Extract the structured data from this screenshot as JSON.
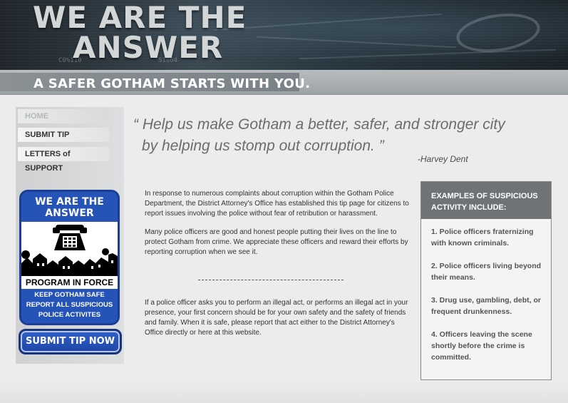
{
  "banner": {
    "title_line1": "WE ARE THE",
    "title_line2": "ANSWER",
    "tagline": "A SAFER GOTHAM STARTS WITH YOU."
  },
  "nav": {
    "items": [
      {
        "label": "HOME",
        "active": true
      },
      {
        "label": "SUBMIT TIP",
        "active": false
      },
      {
        "label": "LETTERS of SUPPORT",
        "active": false
      }
    ]
  },
  "promo": {
    "title_line1": "WE ARE THE",
    "title_line2": "ANSWER",
    "icon": "telephone-icon",
    "banner": "PROGRAM IN FORCE",
    "sub_line1": "KEEP GOTHAM SAFE",
    "sub_line2": "REPORT ALL SUSPICIOUS",
    "sub_line3": "POLICE ACTIVITES"
  },
  "submit_button": "SUBMIT TIP NOW",
  "quote": {
    "line1": "“ Help us make Gotham a better, safer, and stronger city",
    "line2": "by helping us stomp out corruption. ”",
    "author": "-Harvey Dent"
  },
  "body": {
    "para1": "In response to numerous complaints about corruption within the Gotham Police Department, the District Attorney's Office has established this tip page for citizens to report issues involving the police without fear of retribution or harassment.",
    "para2": "Many police officers are good and honest people putting their lives on the line to protect Gotham from crime. We appreciate these officers and reward their efforts by reporting corruption when we see it.",
    "para3": "If a police officer asks you to perform an illegal act, or performs an illegal act in your presence, your first concern should be for your own safety and the safety of friends and family. When it is safe, please report that act either to the District Attorney's Office directly or here at this website."
  },
  "examples": {
    "heading": "EXAMPLES OF SUSPICIOUS ACTIVITY INCLUDE:",
    "items": [
      "1. Police officers fraternizing with known criminals.",
      "2. Police officers living beyond their means.",
      "3. Drug use, gambling, debt, or frequent drunkenness.",
      "4. Officers leaving the scene shortly before the crime is committed."
    ]
  },
  "colors": {
    "accent_blue": "#2553b8",
    "header_dark": "#27353e",
    "tagline_gray": "#9ea3a6",
    "example_head": "#6f7376"
  }
}
